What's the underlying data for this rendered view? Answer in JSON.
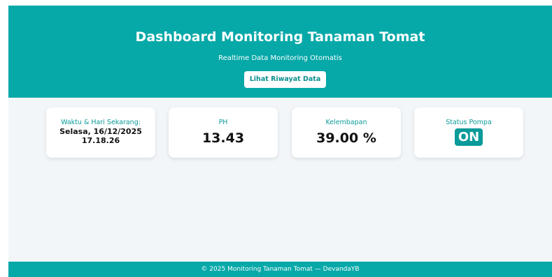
{
  "header": {
    "title": "Dashboard Monitoring Tanaman Tomat",
    "subtitle": "Realtime Data Monitoring Otomatis",
    "history_button": "Lihat Riwayat Data"
  },
  "cards": {
    "time": {
      "label": "Waktu & Hari Sekarang:",
      "date": "Selasa, 16/12/2025",
      "clock": "17.18.26"
    },
    "ph": {
      "label": "PH",
      "value": "13.43"
    },
    "humidity": {
      "label": "Kelembapan",
      "value": "39.00 %"
    },
    "pump": {
      "label": "Status Pompa",
      "status": "ON"
    }
  },
  "footer": {
    "text": "© 2025 Monitoring Tanaman Tomat — DevandaYB"
  },
  "colors": {
    "primary": "#06a8a8",
    "label_teal": "#0c9a9a",
    "badge": "#0a9a9a",
    "background": "#f2f6f9"
  }
}
